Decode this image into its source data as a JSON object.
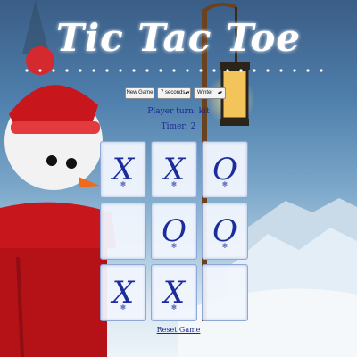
{
  "header": {
    "title": "Tic Tac Toe"
  },
  "controls": {
    "new_game_label": "New Game",
    "timer_select_value": "7 seconds",
    "theme_select_value": "Winter"
  },
  "status": {
    "turn_text": "Player turn: kit",
    "timer_text": "Timer: 2"
  },
  "board": {
    "cells": [
      "X",
      "X",
      "O",
      "",
      "O",
      "O",
      "X",
      "X",
      ""
    ]
  },
  "footer": {
    "reset_label": "Reset Game"
  },
  "colors": {
    "mark": "#1c2c9c",
    "text": "#1b2a8f",
    "cell_bg": "#f1f6fd"
  }
}
